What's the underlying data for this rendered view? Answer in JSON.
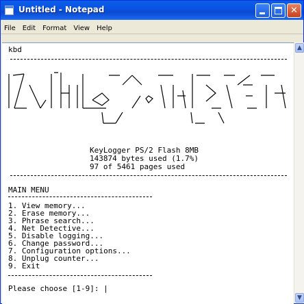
{
  "window": {
    "title": "Untitled - Notepad"
  },
  "menu": [
    "File",
    "Edit",
    "Format",
    "View",
    "Help"
  ],
  "doc": {
    "first_line": "kbd",
    "banner": {
      "product": "KeyLogger PS/2 Flash 8MB",
      "bytes_used": "143874 bytes used (1.7%)",
      "pages_used": "97 of 5461 pages used"
    },
    "menu_title": "MAIN MENU",
    "menu_items": [
      "1. View memory...",
      "2. Erase memory...",
      "3. Phrase search...",
      "4. Net Detective...",
      "5. Disable logging...",
      "6. Change password...",
      "7. Configuration options...",
      "8. Unplug counter...",
      "9. Exit"
    ],
    "prompt": "Please choose [1-9]: |"
  },
  "colors": {
    "titlebar": "#0a54e3",
    "close": "#c8401c",
    "editor_bg": "#ffffff"
  },
  "icons": [
    "notepad-icon",
    "minimize-icon",
    "maximize-icon",
    "close-icon",
    "scroll-up-icon",
    "scroll-down-icon"
  ]
}
